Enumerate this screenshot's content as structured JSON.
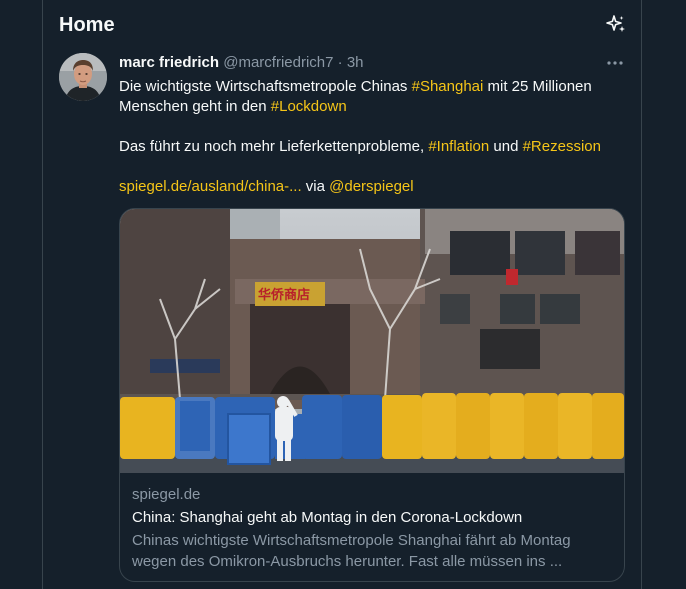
{
  "header": {
    "title": "Home",
    "sparkle_icon": "sparkle-icon"
  },
  "tweet": {
    "author_name": "marc friedrich",
    "handle": "@marcfriedrich7",
    "separator": "·",
    "time": "3h",
    "line1_pre": "Die wichtigste Wirtschaftsmetropole Chinas ",
    "hashtag_shanghai": "#Shanghai",
    "line1_post": " mit 25 Millionen",
    "line2_pre": "Menschen geht in den ",
    "hashtag_lockdown": "#Lockdown",
    "line3_pre": "Das führt zu noch mehr Lieferkettenprobleme, ",
    "hashtag_inflation": "#Inflation",
    "line3_mid": " und ",
    "hashtag_rezession": "#Rezession",
    "url": "spiegel.de/ausland/china-...",
    "via": " via ",
    "mention": "@derspiegel"
  },
  "card": {
    "domain": "spiegel.de",
    "title": "China: Shanghai geht ab Montag in den Corona-Lockdown",
    "description": "Chinas wichtigste Wirtschaftsmetropole Shanghai fährt ab Montag wegen des Omikron-Ausbruchs herunter. Fast alle müssen ins ...",
    "sign_text": "华侨商店"
  },
  "colors": {
    "background": "#15202b",
    "accent": "#f5c518",
    "secondary_text": "#8b98a5",
    "border": "#38444d"
  }
}
